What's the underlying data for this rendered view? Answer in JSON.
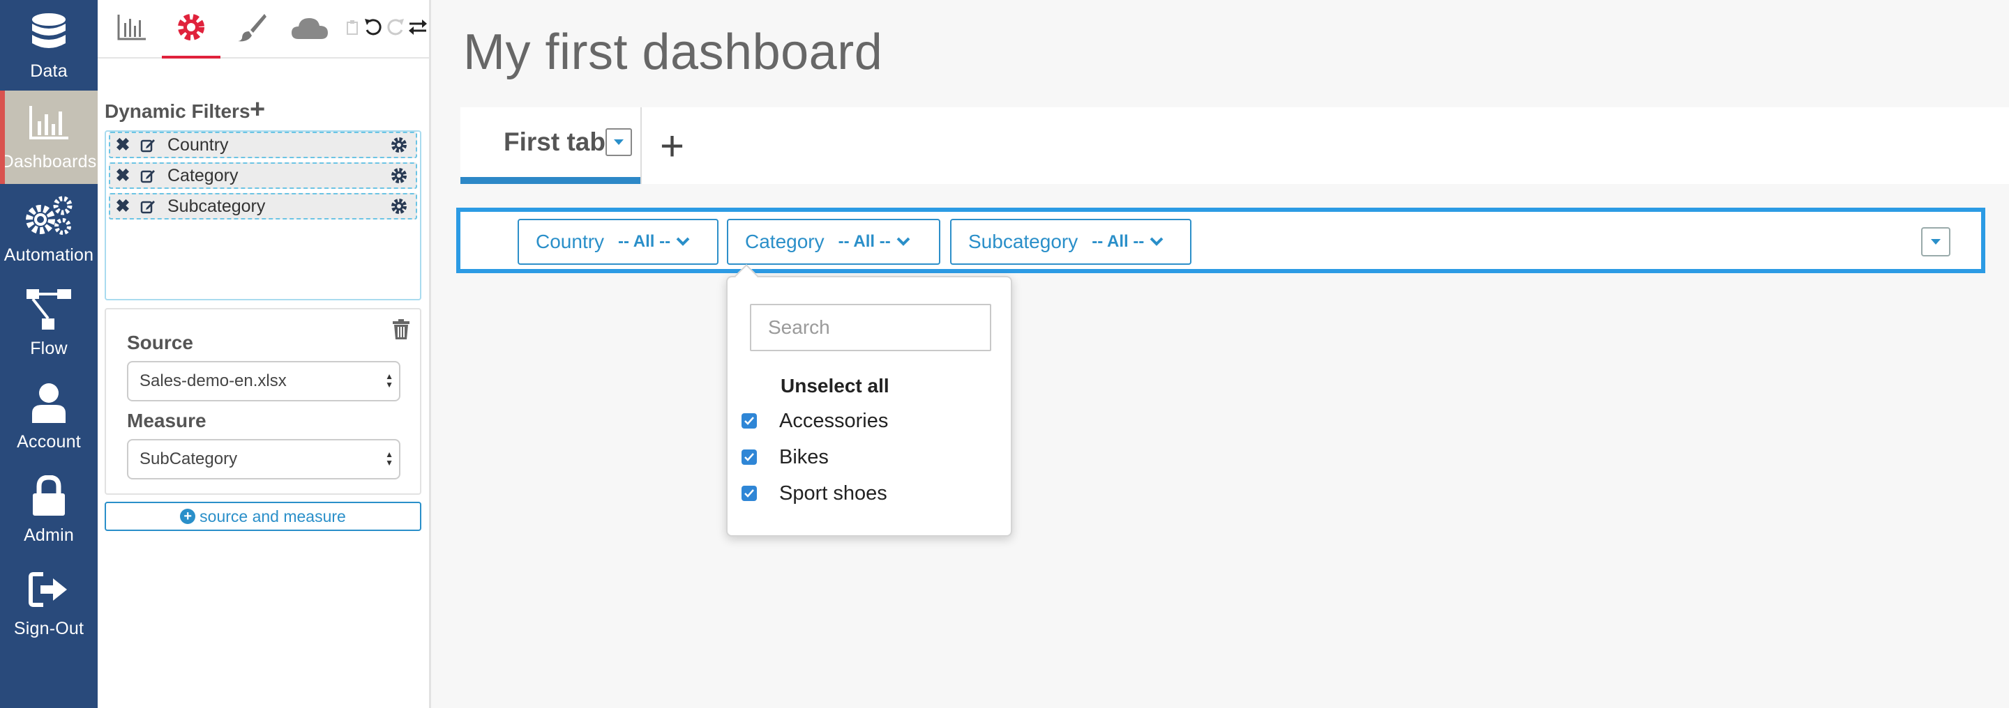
{
  "nav": {
    "items": [
      {
        "label": "Data",
        "icon": "database-icon"
      },
      {
        "label": "Dashboards",
        "icon": "bar-chart-icon",
        "active": true
      },
      {
        "label": "Automation",
        "icon": "gears-icon"
      },
      {
        "label": "Flow",
        "icon": "flow-icon"
      },
      {
        "label": "Account",
        "icon": "user-icon"
      },
      {
        "label": "Admin",
        "icon": "lock-icon"
      },
      {
        "label": "Sign-Out",
        "icon": "sign-out-icon"
      }
    ]
  },
  "toolbar": {
    "tabs": [
      {
        "icon": "chart-icon"
      },
      {
        "icon": "gear-icon",
        "active": true
      },
      {
        "icon": "brush-icon"
      },
      {
        "icon": "cloud-icon"
      }
    ],
    "actions": [
      "paste-icon",
      "undo-icon",
      "redo-icon",
      "swap-icon"
    ]
  },
  "panel": {
    "filters_title": "Dynamic Filters",
    "filters_add": "+",
    "filters": [
      {
        "name": "Country"
      },
      {
        "name": "Category"
      },
      {
        "name": "Subcategory"
      }
    ],
    "source_label": "Source",
    "source_value": "Sales-demo-en.xlsx",
    "measure_label": "Measure",
    "measure_value": "SubCategory",
    "add_source_label": "source and measure"
  },
  "dashboard": {
    "title": "My first dashboard",
    "tabs": [
      {
        "label": "First tab",
        "active": true
      }
    ],
    "add_tab": "+"
  },
  "filter_bar": {
    "filters": [
      {
        "name": "Country",
        "value": "-- All --"
      },
      {
        "name": "Category",
        "value": "-- All --",
        "open": true
      },
      {
        "name": "Subcategory",
        "value": "-- All --"
      }
    ]
  },
  "dropdown": {
    "search_placeholder": "Search",
    "unselect_all": "Unselect all",
    "options": [
      {
        "label": "Accessories",
        "checked": true
      },
      {
        "label": "Bikes",
        "checked": true
      },
      {
        "label": "Sport shoes",
        "checked": true
      }
    ]
  },
  "colors": {
    "nav_bg": "#294a7b",
    "nav_active": "#c5c1b5",
    "accent_red": "#e0223c",
    "accent_blue": "#2c9be4",
    "link_blue": "#2a8fc9",
    "checkbox_blue": "#2f86d6"
  }
}
